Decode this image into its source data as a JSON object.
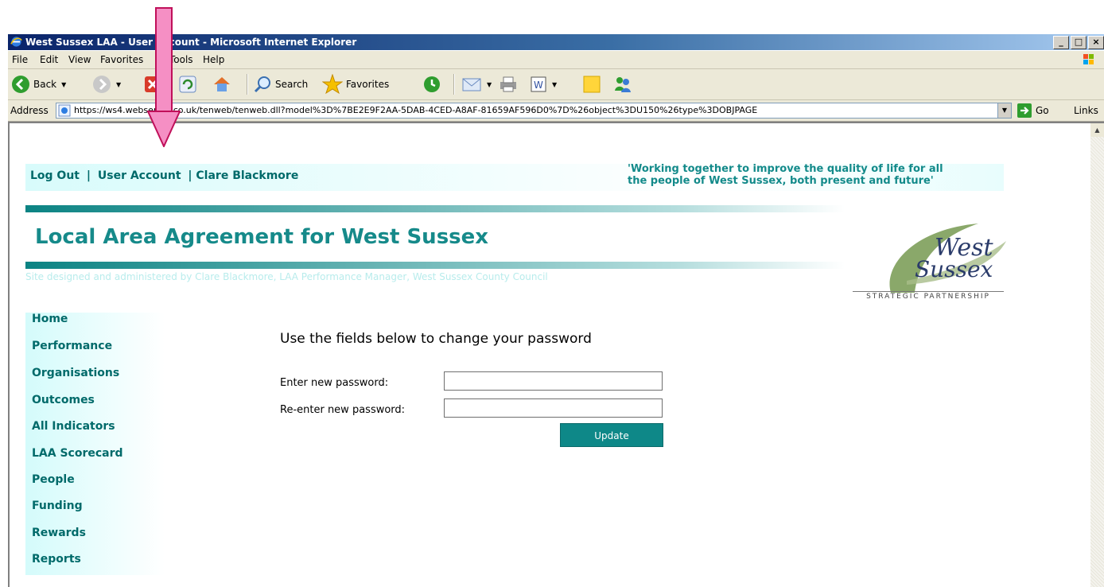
{
  "window": {
    "title": "West Sussex LAA - User Account - Microsoft Internet Explorer",
    "controls": [
      "_",
      "¸",
      "×"
    ]
  },
  "menu": {
    "items": [
      "File",
      "Edit",
      "View",
      "Favorites",
      "Tools",
      "Help"
    ]
  },
  "toolbar": {
    "back_label": "Back",
    "search_label": "Search",
    "favorites_label": "Favorites"
  },
  "address": {
    "label": "Address",
    "url": "https://ws4.webserver.co.uk/tenweb/tenweb.dll?model%3D%7BE2E9F2AA-5DAB-4CED-A8AF-81659AF596D0%7D%26object%3DU150%26type%3DOBJPAGE",
    "go_label": "Go",
    "links_label": "Links"
  },
  "header": {
    "links": [
      "Log Out",
      "|",
      "User Account",
      "| Clare Blackmore"
    ],
    "tagline_line1": "'Working together to improve the quality of life for all",
    "tagline_line2": "the people of West Sussex, both present and future'",
    "site_title": "Local Area Agreement for West Sussex",
    "designed_by": "Site designed and administered by Clare Blackmore, LAA Performance Manager, West Sussex County Council",
    "logo_line1": "West",
    "logo_line2": "Sussex",
    "logo_partnership": "STRATEGIC PARTNERSHIP"
  },
  "nav": {
    "items": [
      "Home",
      "Performance",
      "Organisations",
      "Outcomes",
      "All Indicators",
      "LAA Scorecard",
      "People",
      "Funding",
      "Rewards",
      "Reports"
    ]
  },
  "form": {
    "heading": "Use the fields below to change your password",
    "new_password_label": "Enter new password:",
    "reenter_password_label": "Re-enter new password:",
    "new_password_value": "",
    "reenter_password_value": "",
    "update_label": "Update"
  },
  "colors": {
    "accent": "#168a8a",
    "link": "#006a6a",
    "annotation_arrow": "#f58fc4"
  },
  "icons": [
    "ie-icon",
    "back-arrow-icon",
    "forward-arrow-icon",
    "stop-icon",
    "refresh-icon",
    "home-icon",
    "search-icon",
    "favorites-star-icon",
    "history-icon",
    "mail-icon",
    "print-icon",
    "edit-icon",
    "note-icon",
    "messenger-icon",
    "go-arrow-icon"
  ]
}
